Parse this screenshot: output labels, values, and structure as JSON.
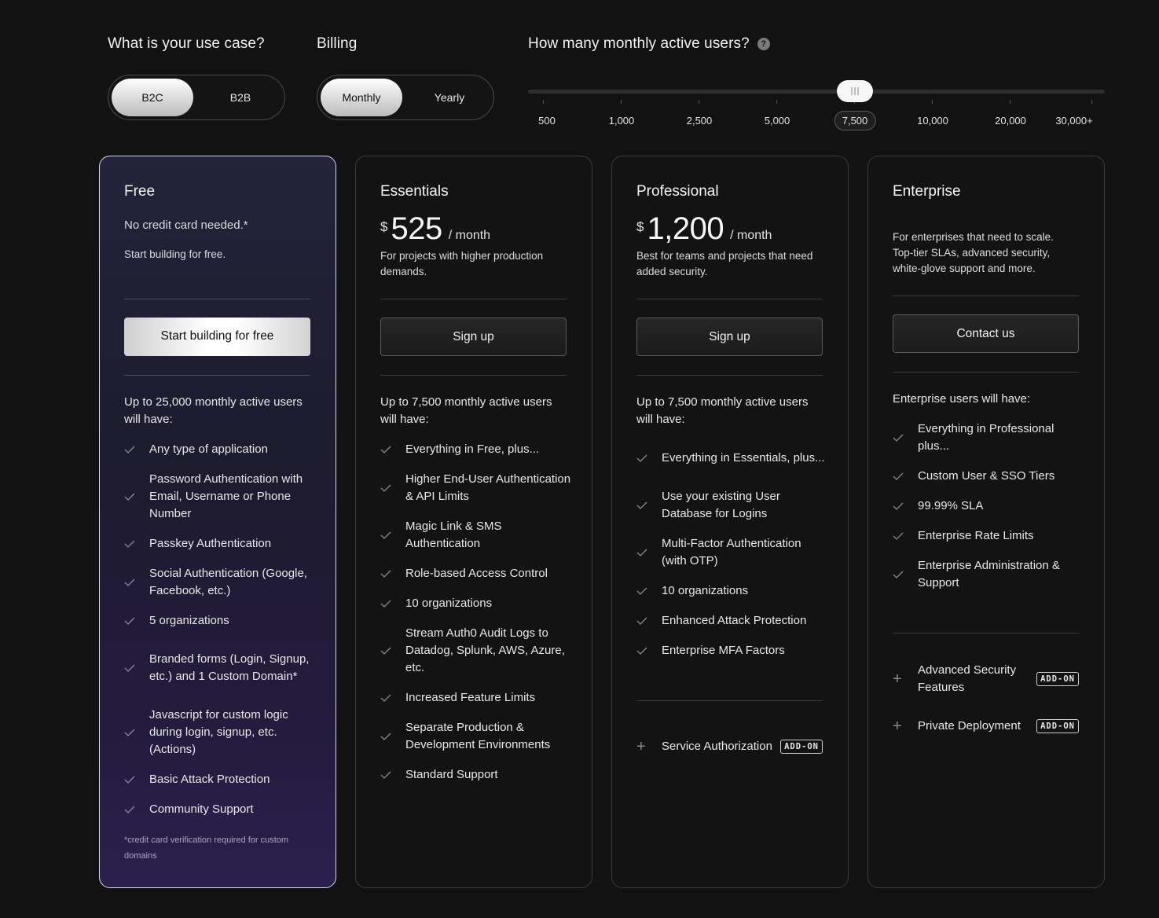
{
  "controls": {
    "use_case_label": "What is your use case?",
    "use_case_options": [
      "B2C",
      "B2B"
    ],
    "use_case_selected": "B2C",
    "billing_label": "Billing",
    "billing_options": [
      "Monthly",
      "Yearly"
    ],
    "billing_selected": "Monthly",
    "users_label": "How many monthly active users?",
    "help_icon": "question-circle-icon",
    "slider_ticks": [
      "500",
      "1,000",
      "2,500",
      "5,000",
      "7,500",
      "10,000",
      "20,000",
      "30,000+"
    ],
    "slider_selected": "7,500"
  },
  "icons": {
    "check": "check-icon",
    "plus": "plus-icon"
  },
  "colors": {
    "background": "#121212",
    "free_card_accent": "#2b1f4d"
  },
  "plans": {
    "free": {
      "name": "Free",
      "tagline": "No credit card needed.*",
      "description": "Start building for free.",
      "button": "Start building for free",
      "features_heading": "Up to 25,000 monthly active users will have:",
      "features": [
        "Any type of application",
        "Password Authentication with Email, Username or Phone Number",
        "Passkey Authentication",
        "Social Authentication (Google, Facebook, etc.)",
        "5 organizations",
        "Branded forms (Login, Signup, etc.) and 1 Custom Domain*",
        "Javascript for custom logic during login, signup, etc. (Actions)",
        "Basic Attack Protection",
        "Community Support"
      ],
      "footnote": "*credit card verification required for custom domains"
    },
    "essentials": {
      "name": "Essentials",
      "currency": "$",
      "price": "525",
      "period": "/ month",
      "description": "For projects with higher production demands.",
      "button": "Sign up",
      "features_heading": "Up to 7,500 monthly active users will have:",
      "features": [
        "Everything in Free, plus...",
        "Higher End-User Authentication & API Limits",
        "Magic Link & SMS Authentication",
        "Role-based Access Control",
        "10 organizations",
        "Stream Auth0 Audit Logs to Datadog, Splunk, AWS, Azure, etc.",
        "Increased Feature Limits",
        "Separate Production & Development Environments",
        "Standard Support"
      ]
    },
    "professional": {
      "name": "Professional",
      "currency": "$",
      "price": "1,200",
      "period": "/ month",
      "description": "Best for teams and projects that need added security.",
      "button": "Sign up",
      "features_heading": "Up to 7,500 monthly active users will have:",
      "features": [
        "Everything in Essentials, plus...",
        "Use your existing User Database for Logins",
        "Multi-Factor Authentication (with OTP)",
        "10 organizations",
        "Enhanced Attack Protection",
        "Enterprise MFA Factors"
      ],
      "addons": [
        {
          "label": "Service Authorization",
          "badge": "ADD-ON"
        }
      ]
    },
    "enterprise": {
      "name": "Enterprise",
      "description": "For enterprises that need to scale. Top-tier SLAs, advanced security, white-glove support and more.",
      "button": "Contact us",
      "features_heading": "Enterprise users will have:",
      "features": [
        "Everything in Professional plus...",
        "Custom User & SSO Tiers",
        "99.99% SLA",
        "Enterprise Rate Limits",
        "Enterprise Administration & Support"
      ],
      "addons": [
        {
          "label": "Advanced Security Features",
          "badge": "ADD-ON"
        },
        {
          "label": "Private Deployment",
          "badge": "ADD-ON"
        }
      ]
    }
  }
}
